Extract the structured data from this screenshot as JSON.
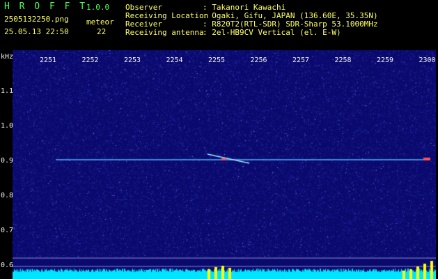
{
  "app": {
    "name": "H R O F F T",
    "version": "1.0.0",
    "filename": "2505132250.png",
    "datetime": "25.05.13 22:50",
    "meteor_label": "meteor",
    "meteor_count": "22"
  },
  "info": [
    {
      "label": "Observer",
      "value": ": Takanori Kawachi"
    },
    {
      "label": "Receiving Location",
      "value": ": Ogaki, Gifu, JAPAN (136.60E, 35.35N)"
    },
    {
      "label": "Receiver",
      "value": ": R820T2(RTL-SDR) SDR-Sharp 53.1000MHz"
    },
    {
      "label": "Receiving antenna",
      "value": ": 2el-HB9CV Vertical (el. E-W)"
    }
  ],
  "spectrogram": {
    "unit_label": "kHz",
    "time_ticks": [
      "2251",
      "2252",
      "2253",
      "2254",
      "2255",
      "2256",
      "2257",
      "2258",
      "2259",
      "2300"
    ],
    "freq_ticks": [
      "1.1",
      "1.0",
      "0.9",
      "0.8",
      "0.7",
      "0.6"
    ],
    "colors": {
      "background": "#0a0a6e",
      "noise": "#3d3dd6",
      "carrier": "#4fb4ff",
      "baseline": "#00e5ff",
      "peaks": "#ffff00"
    }
  }
}
